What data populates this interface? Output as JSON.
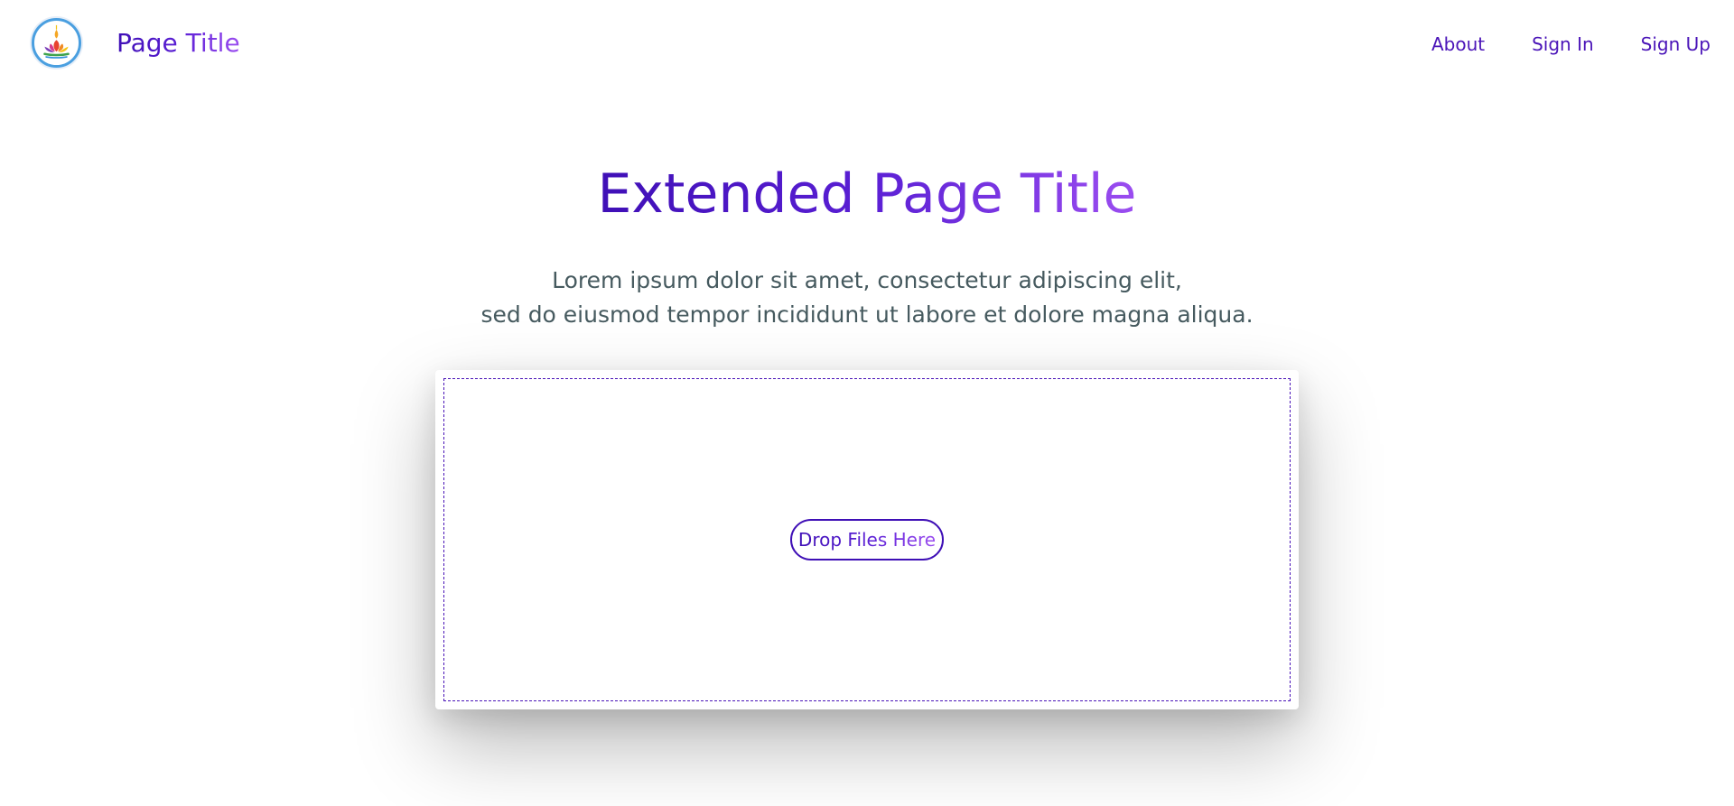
{
  "header": {
    "logo_icon": "lotus-logo-icon",
    "site_title": "Page Title"
  },
  "nav": {
    "items": [
      {
        "label": "About"
      },
      {
        "label": "Sign In"
      },
      {
        "label": "Sign Up"
      }
    ]
  },
  "hero": {
    "title": "Extended Page Title",
    "subtitle_line1": "Lorem ipsum dolor sit amet, consectetur adipiscing elit,",
    "subtitle_line2": "sed do eiusmod tempor incididunt ut labore et dolore magna aliqua."
  },
  "upload": {
    "drop_label": "Drop Files Here"
  },
  "colors": {
    "accent_dark": "#3f0fb6",
    "accent_light": "#9b4df0",
    "text_muted": "#465a5f",
    "logo_ring": "#4a9fe0"
  }
}
